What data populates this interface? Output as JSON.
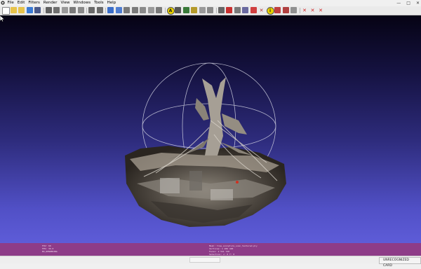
{
  "menu": {
    "items": [
      "File",
      "Edit",
      "Filters",
      "Render",
      "View",
      "Windows",
      "Tools",
      "Help"
    ]
  },
  "window_controls": {
    "minimize": "—",
    "maximize": "□",
    "close": "✕"
  },
  "toolbar": {
    "buttons": [
      {
        "icon": "new-project-icon",
        "color": "#ffffff"
      },
      {
        "icon": "open-project-icon",
        "color": "#e7c34a"
      },
      {
        "icon": "open-mesh-icon",
        "color": "#e7c34a"
      },
      {
        "icon": "reload-icon",
        "color": "#3a7bd5"
      },
      {
        "icon": "save-icon",
        "color": "#4a5a8a"
      },
      {
        "icon": "snapshot-icon",
        "color": "#606060"
      },
      {
        "icon": "layers-icon",
        "color": "#707070"
      },
      {
        "icon": "log-icon",
        "color": "#9a9a9a"
      },
      {
        "icon": "fullscreen-icon",
        "color": "#7a7a7a"
      },
      {
        "icon": "split-view-icon",
        "color": "#8a8a8a"
      },
      {
        "icon": "copy-view-icon",
        "color": "#6a6a6a"
      },
      {
        "icon": "paste-view-icon",
        "color": "#6a6a6a"
      },
      {
        "icon": "points-mode-icon",
        "color": "#3b6ec9"
      },
      {
        "icon": "wireframe-mode-icon",
        "color": "#4f7dd0"
      },
      {
        "icon": "flat-mode-icon",
        "color": "#7a7a7a"
      },
      {
        "icon": "smooth-mode-icon",
        "color": "#7a7a7a"
      },
      {
        "icon": "texture-mode-icon",
        "color": "#8a8a8a"
      },
      {
        "icon": "lighting-icon",
        "color": "#9a9a9a"
      },
      {
        "icon": "bbox-mode-icon",
        "color": "#7a7a7a"
      },
      {
        "icon": "align-icon",
        "color": "#e8d100"
      },
      {
        "icon": "measure-icon",
        "color": "#555555"
      },
      {
        "icon": "pick-points-icon",
        "color": "#3a7a3a"
      },
      {
        "icon": "paint-icon",
        "color": "#b49a2a"
      },
      {
        "icon": "select-vertices-icon",
        "color": "#9a9a9a"
      },
      {
        "icon": "select-faces-icon",
        "color": "#8a8a8a"
      },
      {
        "icon": "pen-icon",
        "color": "#666666"
      },
      {
        "icon": "rainbow-icon",
        "color": "#c83030"
      },
      {
        "icon": "select-connected-icon",
        "color": "#7a7a7a"
      },
      {
        "icon": "select-region-icon",
        "color": "#6a6aa0"
      },
      {
        "icon": "color-picker-icon",
        "color": "#d04040"
      },
      {
        "icon": "delete-faces-icon",
        "color": "#b03030"
      },
      {
        "icon": "info-icon",
        "color": "#e8d100"
      },
      {
        "icon": "brush-icon",
        "color": "#c04040"
      },
      {
        "icon": "scissors-icon",
        "color": "#b04040"
      },
      {
        "icon": "clear-selection-icon",
        "color": "#909090"
      },
      {
        "icon": "delete-selected-icon",
        "color": "#d02020"
      },
      {
        "icon": "delete-vertices-icon",
        "color": "#d02020"
      },
      {
        "icon": "delete-all-icon",
        "color": "#d02020"
      }
    ]
  },
  "info_overlay": {
    "left_lines": [
      "FOV: 60",
      "FPS: 36.0",
      "BO_RENDERING"
    ],
    "right_lines": [
      "Mesh: tree_sculpture_scan_textured.ply",
      "Vertices: 1 282 440",
      "Faces: 2 541 720",
      "Selection: v: 0 f: 0",
      "VC FC WT"
    ]
  },
  "status": {
    "badge": "UNRECOGNIZED CARD"
  },
  "colors": {
    "viewport_top": "#060314",
    "viewport_bottom": "#5e5cd8",
    "info_bar": "#8e3c88",
    "trackball": "#c8c8d8"
  }
}
